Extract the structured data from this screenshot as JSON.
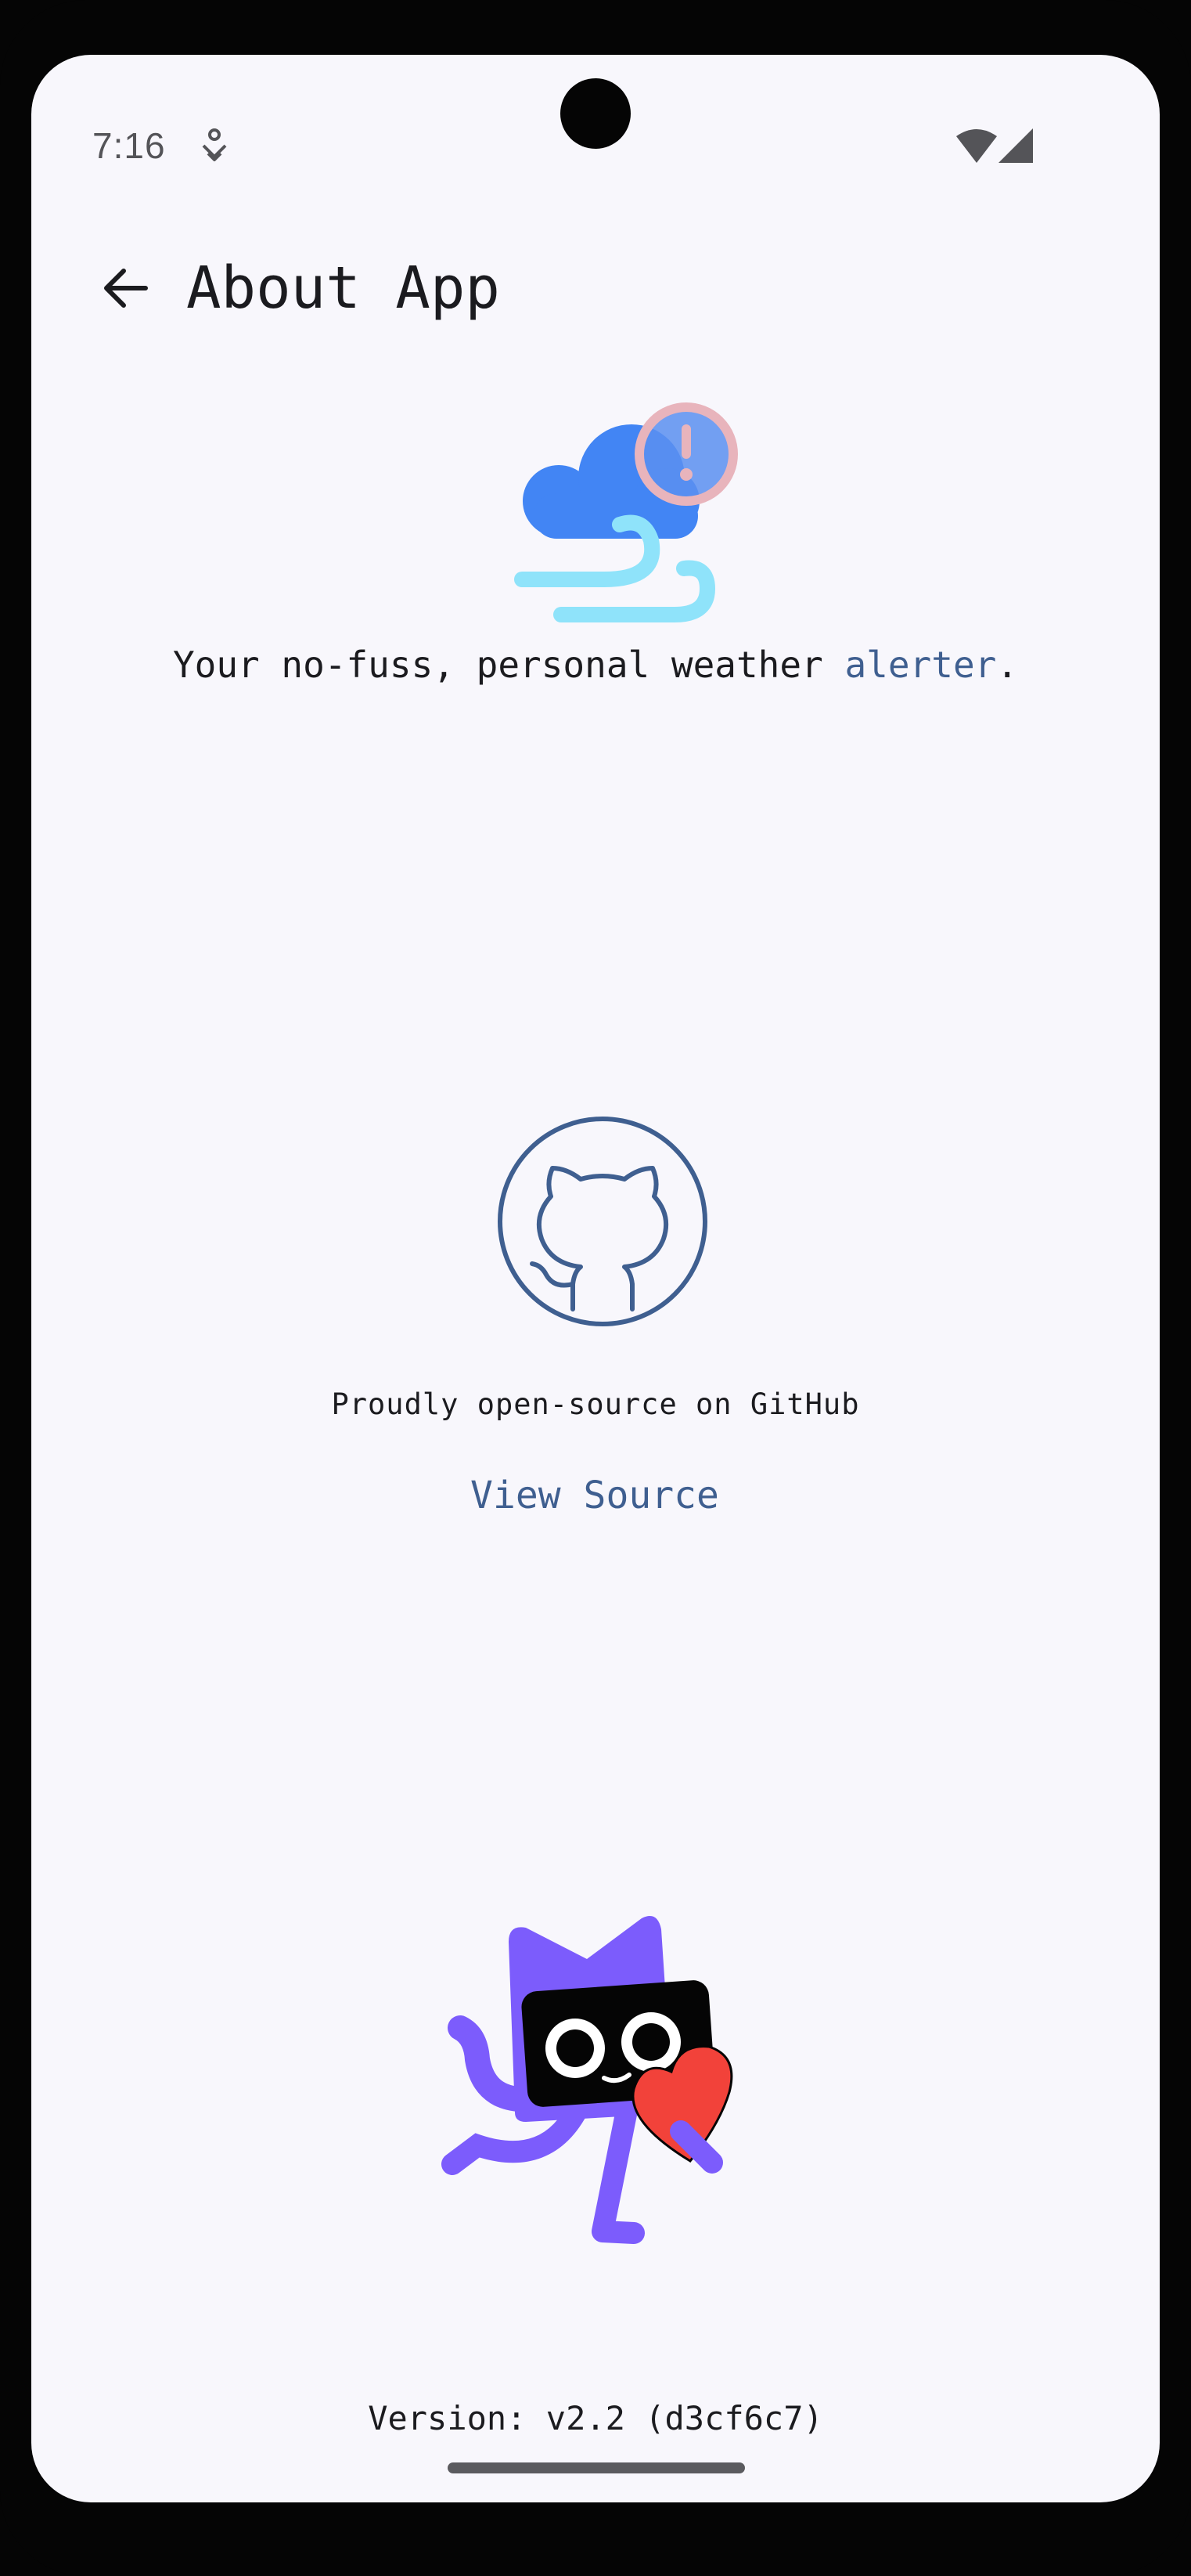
{
  "status_bar": {
    "time": "7:16",
    "icons": [
      "notification-icon",
      "wifi-icon",
      "cell-signal-icon"
    ]
  },
  "app_bar": {
    "title": "About App",
    "back_icon": "arrow-back-icon"
  },
  "hero": {
    "logo_icon": "cloud-wind-alert-icon",
    "tagline_prefix": "Your no-fuss, personal weather ",
    "tagline_highlight": "alerter",
    "tagline_suffix": "."
  },
  "github": {
    "icon": "github-icon",
    "caption": "Proudly open-source on GitHub",
    "link_label": "View Source"
  },
  "footer": {
    "mascot": "mascot-with-heart",
    "version": "Version: v2.2 (d3cf6c7)"
  },
  "colors": {
    "background": "#f8f7fc",
    "text": "#1b1b1f",
    "accent": "#3f5f90",
    "mascot_purple": "#7c5cfc",
    "heart_red": "#f2423a",
    "cloud_blue": "#4285f4",
    "wind_cyan": "#8fe3fa",
    "alert_pink": "#e8b4bc"
  }
}
